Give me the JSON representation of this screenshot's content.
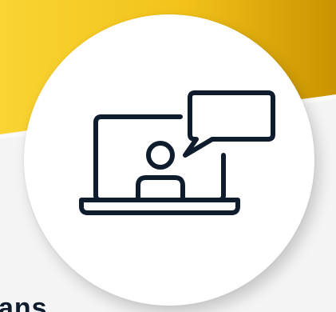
{
  "colors": {
    "gold_light": "#f7cf2a",
    "gold_dark": "#d9a300",
    "navy": "#0f1c2e",
    "white": "#ffffff"
  },
  "graphic": {
    "icon": "laptop-video-chat-icon"
  },
  "caption": {
    "partial_text": "ans"
  }
}
